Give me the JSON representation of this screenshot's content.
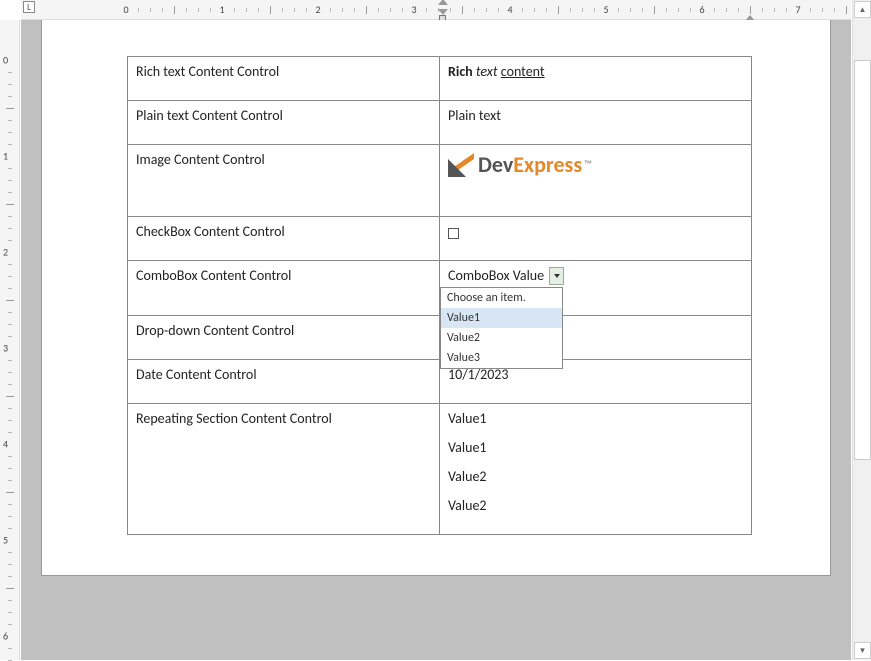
{
  "ruler": {
    "horizontal_numbers": [
      "1",
      "0",
      "1",
      "2",
      "3",
      "4",
      "5",
      "6",
      "7"
    ],
    "l_label": "L"
  },
  "rows": {
    "richtext": {
      "label": "Rich text Content Control",
      "parts": {
        "bold": "Rich",
        "italic": " text ",
        "underline": "content"
      }
    },
    "plaintext": {
      "label": "Plain text Content Control",
      "value": "Plain text"
    },
    "image": {
      "label": "Image Content Control",
      "logo_dev": "Dev",
      "logo_express": "Express",
      "logo_tm": "™"
    },
    "checkbox": {
      "label": "CheckBox Content Control"
    },
    "combobox": {
      "label": "ComboBox Content Control",
      "value": "ComboBox Value",
      "options": {
        "placeholder": "Choose an item.",
        "o1": "Value1",
        "o2": "Value2",
        "o3": "Value3"
      }
    },
    "dropdown": {
      "label": "Drop-down Content Control",
      "value": ""
    },
    "date": {
      "label": "Date Content Control",
      "value": "10/1/2023"
    },
    "repeating": {
      "label": "Repeating Section Content Control",
      "v1": "Value1",
      "v2": "Value1",
      "v3": "Value2",
      "v4": "Value2"
    }
  }
}
